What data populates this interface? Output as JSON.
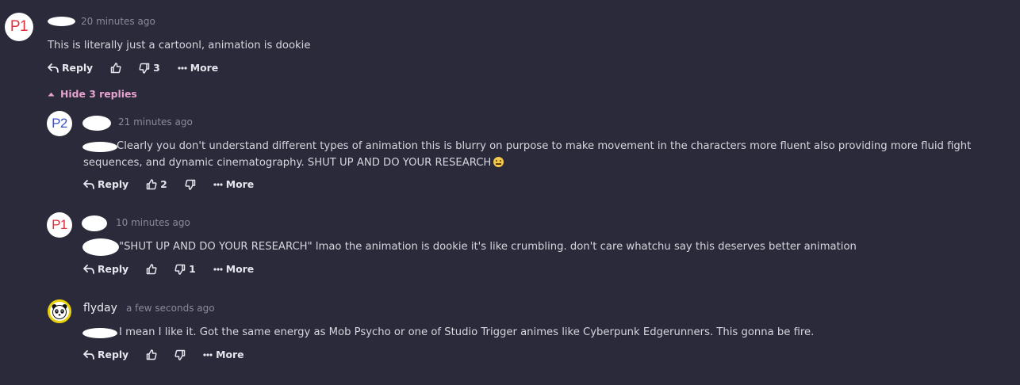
{
  "hide_replies_label": "Hide 3 replies",
  "action_labels": {
    "reply": "Reply",
    "more": "More"
  },
  "comments": [
    {
      "avatar_text": "P1",
      "timestamp": "20 minutes ago",
      "text": "This is literally just a cartoonl, animation is dookie",
      "dislike_count": "3"
    },
    {
      "avatar_text": "P2",
      "timestamp": "21 minutes ago",
      "text": "Clearly you don't understand different types of animation this is blurry on purpose to make movement in the characters more fluent also providing more fluid fight sequences, and dynamic cinematography. SHUT UP AND DO YOUR RESEARCH",
      "like_count": "2"
    },
    {
      "avatar_text": "P1",
      "timestamp": "10 minutes ago",
      "text": "\"SHUT UP AND DO YOUR RESEARCH\" lmao the animation is dookie it's like crumbling. don't care whatchu say this deserves better animation",
      "dislike_count": "1"
    },
    {
      "username": "flyday",
      "timestamp": "a few seconds ago",
      "text": "I mean I like it. Got the same energy as Mob Psycho or one of Studio Trigger animes like Cyberpunk Edgerunners. This gonna be fire."
    }
  ]
}
